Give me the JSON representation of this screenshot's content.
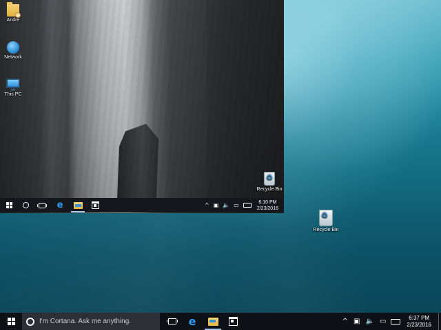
{
  "inner_desktop": {
    "icons": [
      {
        "label": "Andre",
        "icon": "user-folder-icon"
      },
      {
        "label": "Network",
        "icon": "network-icon"
      },
      {
        "label": "This PC",
        "icon": "this-pc-icon"
      },
      {
        "label": "Recycle Bin",
        "icon": "recycle-bin-icon"
      }
    ],
    "taskbar": {
      "pinned": [
        "start-icon",
        "cortana-icon",
        "task-view-icon",
        "edge-icon",
        "file-explorer-icon",
        "store-icon"
      ],
      "tray_icons": [
        "chevron-up-icon",
        "action-center-icon",
        "volume-icon",
        "message-icon",
        "keyboard-icon"
      ],
      "time": "6:10 PM",
      "date": "2/23/2016"
    }
  },
  "desktop": {
    "icons": [
      {
        "label": "Recycle Bin",
        "icon": "recycle-bin-icon"
      }
    ]
  },
  "taskbar": {
    "cortana_placeholder": "I'm Cortana. Ask me anything.",
    "pinned": [
      "start-icon",
      "task-view-icon",
      "edge-icon",
      "file-explorer-icon",
      "store-icon"
    ],
    "tray_icons": [
      "chevron-up-icon",
      "action-center-icon",
      "volume-icon",
      "message-icon",
      "keyboard-icon"
    ],
    "time": "6:37 PM",
    "date": "2/23/2016"
  }
}
